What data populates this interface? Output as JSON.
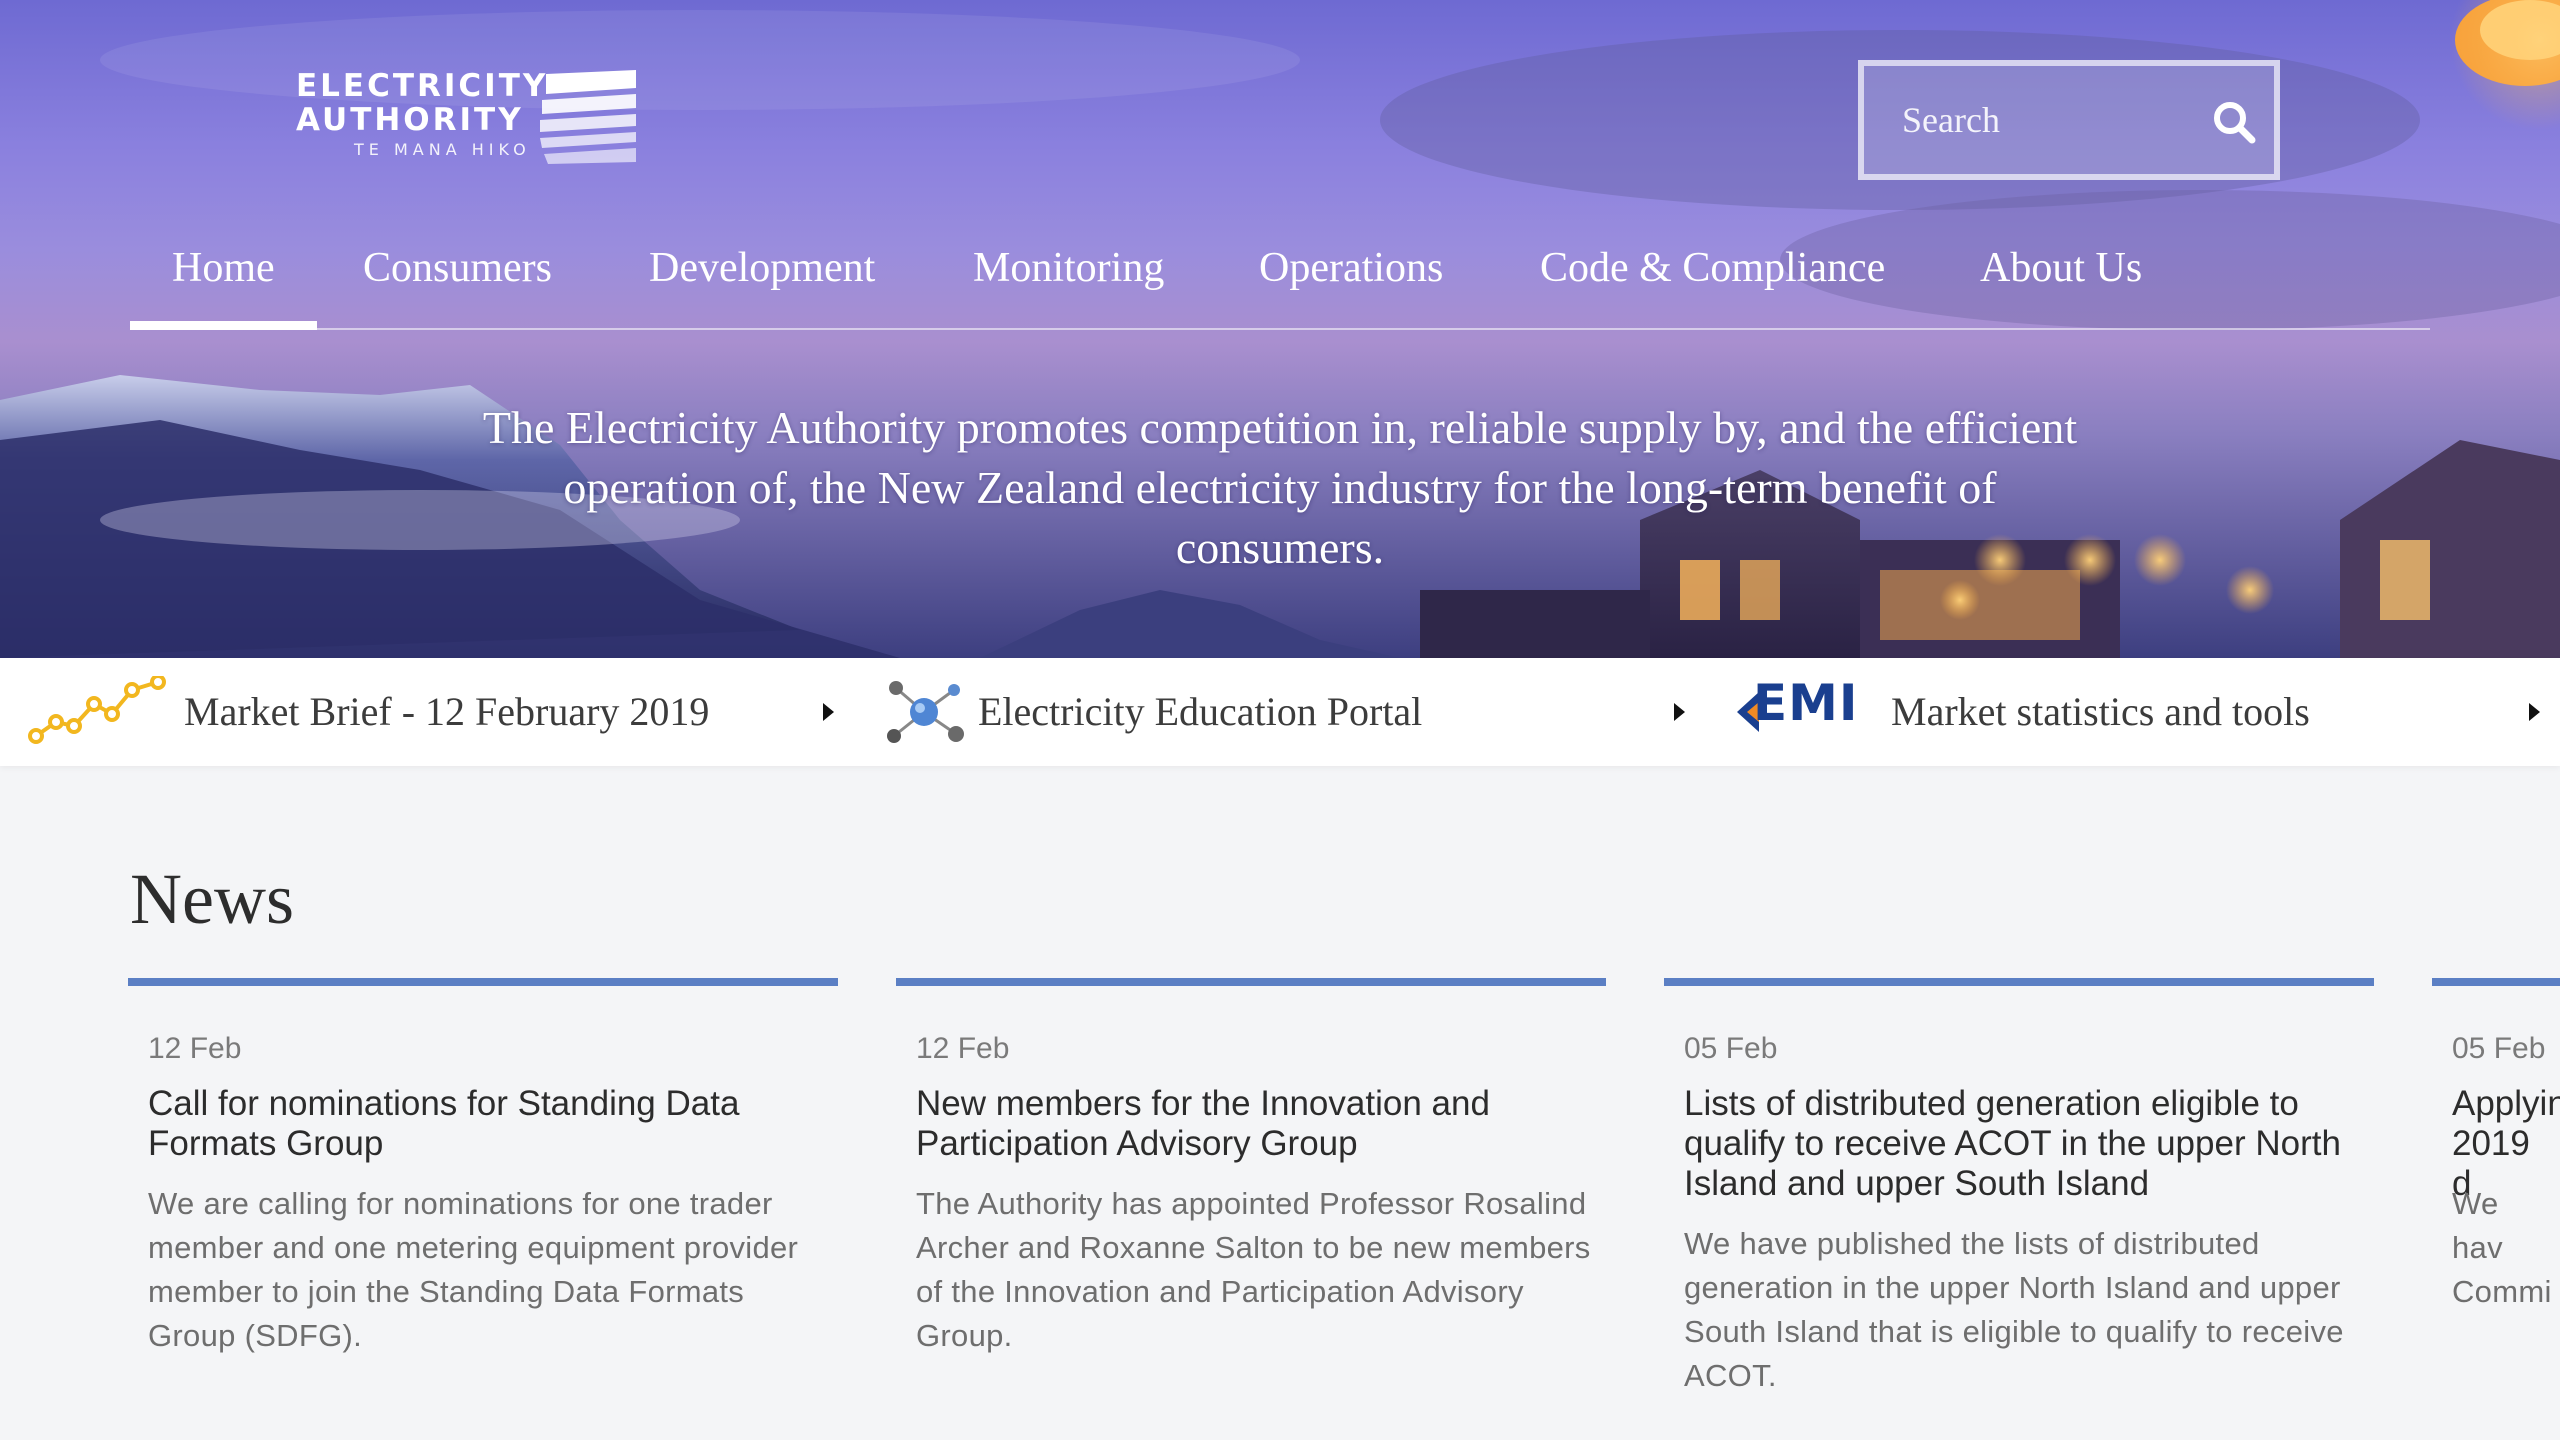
{
  "header": {
    "logo": {
      "line1": "ELECTRICITY",
      "line2": "AUTHORITY",
      "line3": "TE MANA HIKO"
    },
    "search": {
      "placeholder": "Search"
    },
    "nav": [
      {
        "label": "Home",
        "active": true
      },
      {
        "label": "Consumers"
      },
      {
        "label": "Development"
      },
      {
        "label": "Monitoring"
      },
      {
        "label": "Operations"
      },
      {
        "label": "Code & Compliance"
      },
      {
        "label": "About Us"
      }
    ],
    "tagline": "The Electricity Authority promotes competition in, reliable supply by, and the efficient operation of, the New Zealand electricity industry for the long-term benefit of consumers."
  },
  "quicklinks": [
    {
      "label": "Market Brief - 12 February 2019",
      "icon": "line-graph-icon"
    },
    {
      "label": "Electricity Education Portal",
      "icon": "molecule-icon"
    },
    {
      "label": "Market statistics and tools",
      "icon": "emi-logo-icon",
      "logo_text": "EMI"
    }
  ],
  "news": {
    "title": "News",
    "items": [
      {
        "date": "12 Feb",
        "title": "Call for nominations for Standing Data Formats Group",
        "summary": "We are calling for nominations for one trader member and one metering equipment provider member to join the Standing Data Formats Group (SDFG)."
      },
      {
        "date": "12 Feb",
        "title": "New members for the Innovation and Participation Advisory Group",
        "summary": "The Authority has appointed Professor Rosalind Archer and Roxanne Salton to be new members of the Innovation and Participation Advisory Group."
      },
      {
        "date": "05 Feb",
        "title": "Lists of distributed generation eligible to qualify to receive ACOT in the upper North Island and upper South Island",
        "summary": "We have published the lists of distributed generation in the upper North Island and upper South Island that is eligible to qualify to receive ACOT."
      },
      {
        "date": "05 Feb",
        "title": "Applyin 2019 d",
        "summary": "We hav Commi"
      }
    ]
  },
  "colors": {
    "accent": "#5b7fc4",
    "emi": "#1a3f8f",
    "market_brief_icon": "#f2b71f"
  }
}
